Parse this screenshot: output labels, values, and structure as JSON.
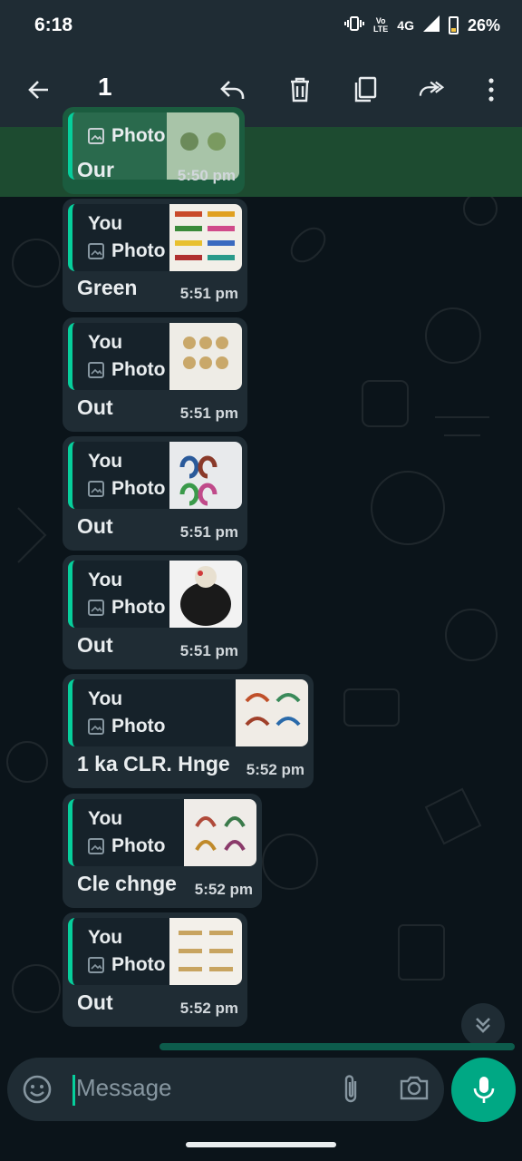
{
  "status_bar": {
    "time": "6:18",
    "network_top": "Vo",
    "network_bottom": "LTE",
    "network_type": "4G",
    "battery": "26%"
  },
  "toolbar": {
    "selected_count": "1",
    "icons": [
      "back-arrow-icon",
      "reply-icon",
      "delete-icon",
      "copy-icon",
      "forward-icon",
      "more-vert-icon"
    ]
  },
  "messages": [
    {
      "quote_author": "",
      "quote_type": "Photo",
      "text": "Our",
      "time": "5:50 pm",
      "selected": true
    },
    {
      "quote_author": "You",
      "quote_type": "Photo",
      "text": "Green",
      "time": "5:51 pm"
    },
    {
      "quote_author": "You",
      "quote_type": "Photo",
      "text": "Out",
      "time": "5:51 pm"
    },
    {
      "quote_author": "You",
      "quote_type": "Photo",
      "text": "Out",
      "time": "5:51 pm"
    },
    {
      "quote_author": "You",
      "quote_type": "Photo",
      "text": "Out",
      "time": "5:51 pm"
    },
    {
      "quote_author": "You",
      "quote_type": "Photo",
      "text": "1 ka CLR. Hnge",
      "time": "5:52 pm"
    },
    {
      "quote_author": "You",
      "quote_type": "Photo",
      "text": "Cle chnge",
      "time": "5:52 pm"
    },
    {
      "quote_author": "You",
      "quote_type": "Photo",
      "text": "Out",
      "time": "5:52 pm"
    }
  ],
  "composer": {
    "placeholder": "Message"
  },
  "colors": {
    "accent": "#00a884",
    "bubble": "#1f2c34",
    "quote_bar": "#06cf9c",
    "background": "#0b141a",
    "selection": "#1d4b30"
  }
}
